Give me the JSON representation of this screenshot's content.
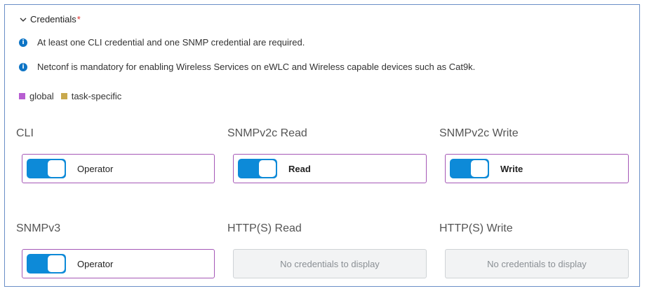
{
  "section": {
    "title": "Credentials",
    "required_mark": "*"
  },
  "info": [
    "At least one CLI credential and one SNMP credential are required.",
    "Netconf is mandatory for enabling Wireless Services on eWLC and Wireless capable devices such as Cat9k."
  ],
  "legend": [
    {
      "label": "global",
      "color": "#b75ed1"
    },
    {
      "label": "task-specific",
      "color": "#c9a94d"
    }
  ],
  "cards": {
    "cli": {
      "label": "CLI",
      "value": "Operator",
      "enabled": true
    },
    "snmpv2c_read": {
      "label": "SNMPv2c Read",
      "value": "Read",
      "enabled": true
    },
    "snmpv2c_write": {
      "label": "SNMPv2c Write",
      "value": "Write",
      "enabled": true
    },
    "snmpv3": {
      "label": "SNMPv3",
      "value": "Operator",
      "enabled": true
    },
    "http_read": {
      "label": "HTTP(S) Read",
      "empty_text": "No credentials to display"
    },
    "http_write": {
      "label": "HTTP(S) Write",
      "empty_text": "No credentials to display"
    }
  },
  "colors": {
    "accent": "#0d8ad8",
    "global_border": "#a557b6",
    "info_icon": "#0d74c5"
  },
  "icons": {
    "collapse": "chevron-down-icon",
    "info": "info-icon"
  }
}
